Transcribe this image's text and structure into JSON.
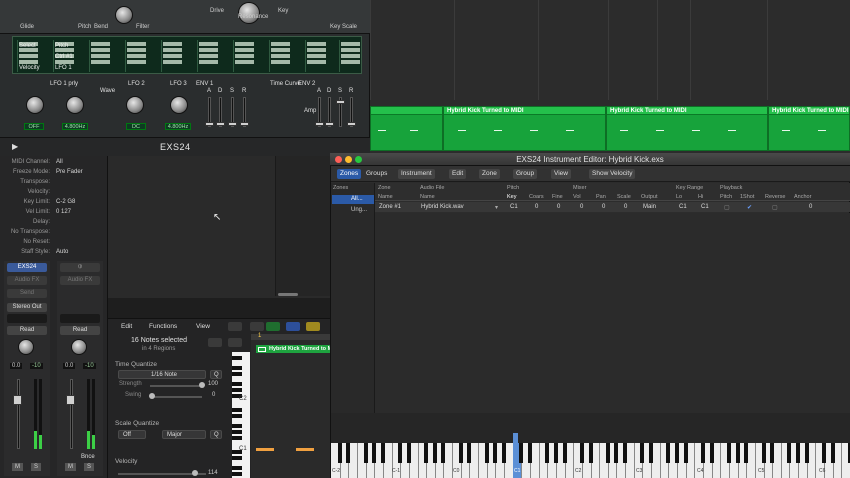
{
  "synth": {
    "title": "EXS24",
    "top_labels": [
      "Glide",
      "Pitch",
      "Bend",
      "Filter",
      "Drive",
      "Key",
      "Resonance",
      "Key Scale"
    ],
    "mod_labels": [
      "Select",
      "Velocity",
      "Pitch",
      "Ctrl #1",
      "LFO 1"
    ],
    "sections": {
      "lfo1": "LFO 1 prly",
      "lfo2": "LFO 2",
      "lfo3": "LFO 3",
      "wave": "Wave",
      "env1": "ENV 1",
      "env2": "ENV 2",
      "time_curve": "Time Curve",
      "amp": "Amp"
    },
    "lcds": [
      "OFF",
      "4.800Hz",
      "DC",
      "4.800Hz"
    ],
    "adsr": [
      "A",
      "D",
      "S",
      "R"
    ]
  },
  "tracks": {
    "regions": [
      {
        "label": "Hybrid Kick Turned to MIDI"
      },
      {
        "label": "Hybrid Kick Turned to MIDI"
      },
      {
        "label": "Hybrid Kick Turned to MIDI"
      }
    ]
  },
  "inspector": {
    "props": [
      {
        "k": "MIDI Channel:",
        "v": "All"
      },
      {
        "k": "Freeze Mode:",
        "v": "Pre Fader"
      },
      {
        "k": "Transpose:",
        "v": ""
      },
      {
        "k": "Velocity:",
        "v": ""
      },
      {
        "k": "Key Limit:",
        "v": "C-2    G8"
      },
      {
        "k": "Vel Limit:",
        "v": "0    127"
      },
      {
        "k": "Delay:",
        "v": ""
      },
      {
        "k": "No Transpose:",
        "v": ""
      },
      {
        "k": "No Reset:",
        "v": ""
      },
      {
        "k": "Staff Style:",
        "v": "Auto"
      }
    ],
    "strip1": {
      "instrument": "EXS24",
      "audio_fx": "Audio FX",
      "send": "Send",
      "output": "Stereo Out",
      "read": "Read",
      "vol": "0.0",
      "pk": "-10",
      "m": "M",
      "s": "S"
    },
    "strip2": {
      "audio_fx": "Audio FX",
      "read": "Read",
      "vol": "0.0",
      "pk": "-10",
      "name": "Bnce",
      "m": "M",
      "s": "S"
    }
  },
  "piano_roll": {
    "menus": [
      "Edit",
      "Functions",
      "View"
    ],
    "notes_selected": "16 Notes selected",
    "in_regions": "in 4 Regions",
    "time_quantize": "Time Quantize",
    "note_value": "1/16 Note",
    "q": "Q",
    "strength": "Strength",
    "strength_val": "100",
    "swing": "Swing",
    "swing_val": "0",
    "scale_quantize": "Scale Quantize",
    "scale_off": "Off",
    "scale_mode": "Major",
    "velocity": "Velocity",
    "velocity_val": "114",
    "region_label": "Hybrid Kick Turned to M",
    "bar": "1",
    "key_c2": "C2",
    "key_c1": "C1"
  },
  "editor": {
    "title": "EXS24 Instrument Editor: Hybrid Kick.exs",
    "tabs": [
      "Zones",
      "Groups"
    ],
    "menus": [
      "Instrument",
      "Edit",
      "Zone",
      "Group",
      "View"
    ],
    "show_velocity": "Show Velocity",
    "zones_header": "Zones",
    "zones_list": [
      "All...",
      "Ung..."
    ],
    "group_headers": [
      "Zone",
      "Audio File",
      "Pitch",
      "Mixer",
      "Key Range",
      "Playback"
    ],
    "col_headers": [
      "Name",
      "Name",
      "Key",
      "Coars",
      "Fine",
      "Vol",
      "Pan",
      "Scale",
      "Output",
      "Lo",
      "Hi",
      "Pitch",
      "1Shot",
      "Reverse",
      "Anchor"
    ],
    "row": {
      "zone": "Zone #1",
      "file": "Hybrid Kick.wav",
      "key": "C1",
      "coarse": "0",
      "fine": "0",
      "vol": "0",
      "pan": "0",
      "scale": "0",
      "output": "Main",
      "lo": "C1",
      "hi": "C1",
      "anchor": "0"
    },
    "keyboard_labels": [
      "C-2",
      "C-1",
      "C0",
      "C1",
      "C2",
      "C3",
      "C4",
      "C5",
      "C6"
    ]
  }
}
